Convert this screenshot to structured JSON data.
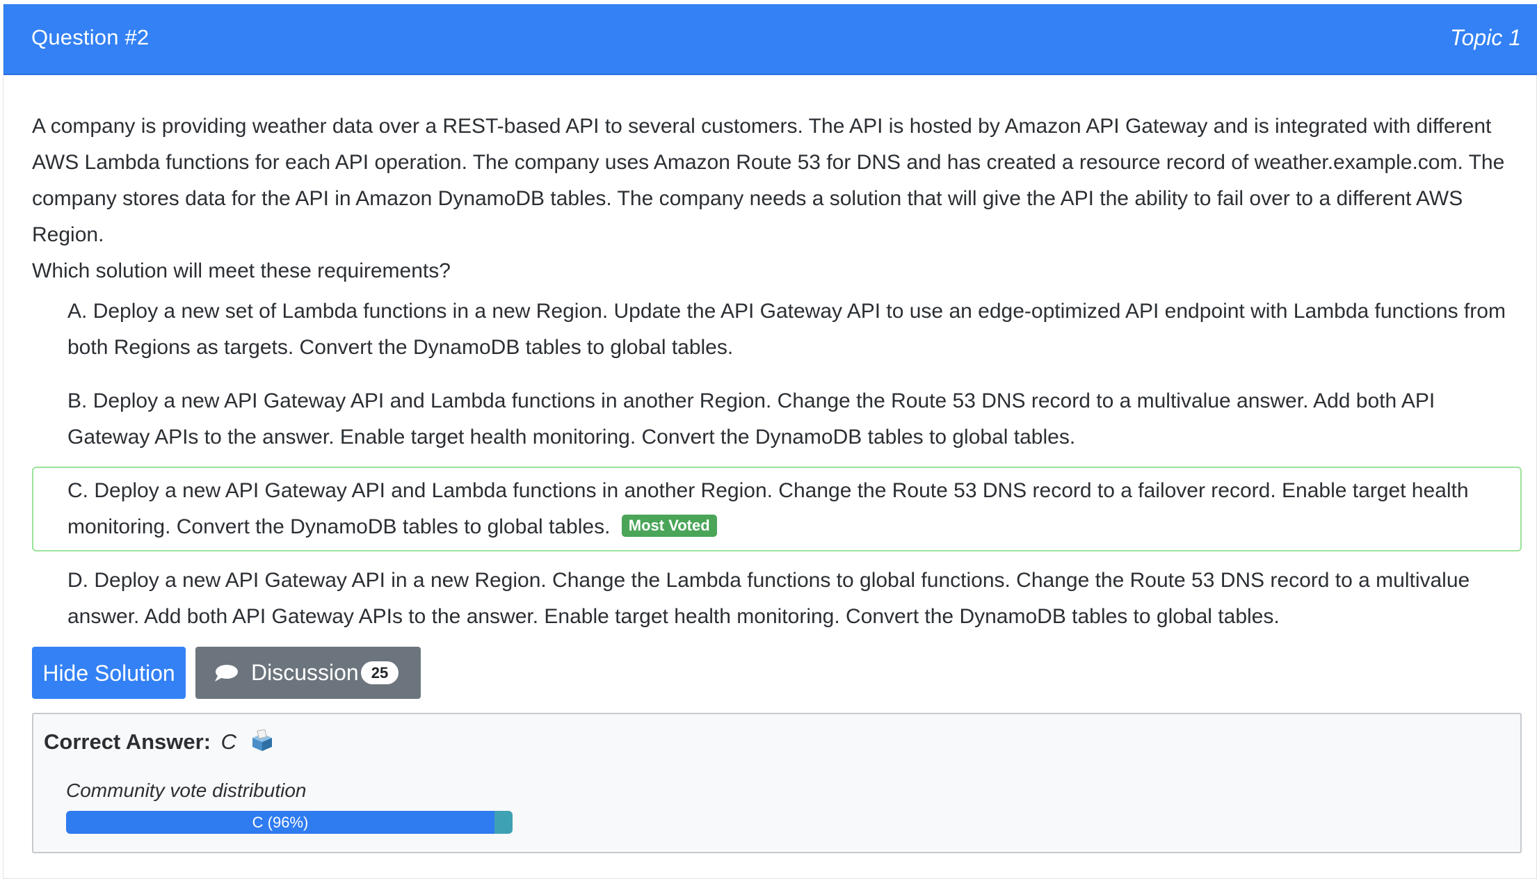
{
  "header": {
    "question_label": "Question #2",
    "topic_label": "Topic 1",
    "background_color": "#3381f5"
  },
  "question": {
    "paragraph": "A company is providing weather data over a REST-based API to several customers. The API is hosted by Amazon API Gateway and is integrated with different AWS Lambda functions for each API operation. The company uses Amazon Route 53 for DNS and has created a resource record of weather.example.com. The company stores data for the API in Amazon DynamoDB tables. The company needs a solution that will give the API the ability to fail over to a different AWS Region.",
    "prompt": "Which solution will meet these requirements?"
  },
  "choices": [
    {
      "letter": "A.",
      "text": "Deploy a new set of Lambda functions in a new Region. Update the API Gateway API to use an edge-optimized API endpoint with Lambda functions from both Regions as targets. Convert the DynamoDB tables to global tables."
    },
    {
      "letter": "B.",
      "text": "Deploy a new API Gateway API and Lambda functions in another Region. Change the Route 53 DNS record to a multivalue answer. Add both API Gateway APIs to the answer. Enable target health monitoring. Convert the DynamoDB tables to global tables."
    },
    {
      "letter": "C.",
      "text": "Deploy a new API Gateway API and Lambda functions in another Region. Change the Route 53 DNS record to a failover record. Enable target health monitoring. Convert the DynamoDB tables to global tables.",
      "badge": "Most Voted",
      "highlight_color": "#9ae39a"
    },
    {
      "letter": "D.",
      "text": "Deploy a new API Gateway API in a new Region. Change the Lambda functions to global functions. Change the Route 53 DNS record to a multivalue answer. Add both API Gateway APIs to the answer. Enable target health monitoring. Convert the DynamoDB tables to global tables."
    }
  ],
  "actions": {
    "hide_solution_label": "Hide Solution",
    "discussion_label": "Discussion",
    "discussion_count": "25",
    "discussion_icon": "speech-bubble-icon"
  },
  "answer": {
    "label": "Correct Answer:",
    "value": "C",
    "icon": "ballot-box-icon",
    "vote_title": "Community vote distribution",
    "vote_label": "C (96%)",
    "vote_fraction_c": 0.96,
    "vote_colors": {
      "c": "#2f7bf0",
      "other": "#3fa1b4"
    }
  }
}
